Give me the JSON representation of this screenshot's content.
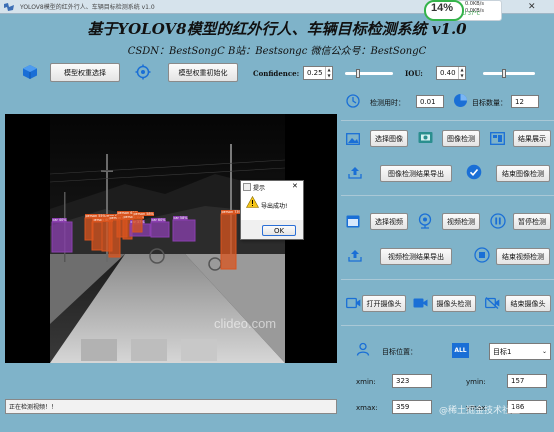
{
  "window": {
    "title": "YOLOV8模型的红外行人、车辆目标检测系统 v1.0",
    "close_glyph": "✕"
  },
  "monitor": {
    "cpu_percent": "14%",
    "net_up": "0.0KB/s",
    "net_down": "0.0KB/s",
    "cpu_temp": "CPU 37°C"
  },
  "header": {
    "title": "基于YOLOV8模型的红外行人、车辆目标检测系统 v1.0",
    "subtitle": "CSDN：BestSongC B站：Bestsongc 微信公众号：BestSongC"
  },
  "toolbar": {
    "select_weights": "模型权重选择",
    "init_weights": "模型权重初始化",
    "confidence_label": "Confidence:",
    "confidence_value": "0.25",
    "confidence_level": 0.25,
    "iou_label": "IOU:",
    "iou_value": "0.40",
    "iou_level": 0.4
  },
  "stats": {
    "time_label": "检测用时：",
    "time_value": "0.01",
    "count_label": "目标数量：",
    "count_value": "12"
  },
  "image_section": {
    "select_image": "选择图像",
    "detect_image": "图像检测",
    "show_results": "结果展示",
    "export_image": "图像检测结果导出",
    "stop_image": "结束图像检测"
  },
  "video_section": {
    "select_video": "选择视频",
    "detect_video": "视频检测",
    "pause_detect": "暂停检测",
    "export_video": "视频检测结果导出",
    "stop_video": "结束视频检测"
  },
  "camera_section": {
    "open_camera": "打开摄像头",
    "camera_detect": "摄像头检测",
    "close_camera": "结束摄像头"
  },
  "target": {
    "position_label": "目标位置：",
    "all_badge": "ALL",
    "selected": "目标1",
    "xmin_label": "xmin:",
    "xmin_value": "323",
    "ymin_label": "ymin:",
    "ymin_value": "157",
    "xmax_label": "xmax:",
    "xmax_value": "359",
    "ymax_label": "ymax:",
    "ymax_value": "186"
  },
  "status": {
    "text": "正在检测视频！！"
  },
  "dialog": {
    "title": "提示",
    "close_glyph": "✕",
    "message": "导出成功!",
    "ok": "OK"
  },
  "video": {
    "watermark": "clideo.com",
    "labels": [
      "person 60%",
      "person 67%",
      "person 63%",
      "person 61%",
      "person 70%",
      "person 73%",
      "car 40%",
      "car 37%",
      "car 60%",
      "car 58%",
      "person 55%",
      "person 58%"
    ]
  },
  "corner_watermark": "@稀土掘金技术社区",
  "colors": {
    "background": "#7fb3c9",
    "person_box": "#d9541e",
    "car_box": "#8b3fb0",
    "accent_blue": "#1a6fd6",
    "cpu_green": "#34b34a"
  },
  "icons": {
    "cube": "cube-icon",
    "settings": "gear-icon",
    "clock": "clock-icon",
    "pie": "pie-chart-icon",
    "image": "image-icon",
    "image_detect": "image-detect-icon",
    "slideshow": "slideshow-icon",
    "upload": "upload-icon",
    "check": "check-circle-icon",
    "video": "video-icon",
    "webcam": "webcam-icon",
    "pause": "pause-icon",
    "stop": "stop-icon",
    "camera": "camera-icon",
    "camera_off": "camera-off-icon",
    "person": "person-icon",
    "warning": "warning-icon"
  }
}
